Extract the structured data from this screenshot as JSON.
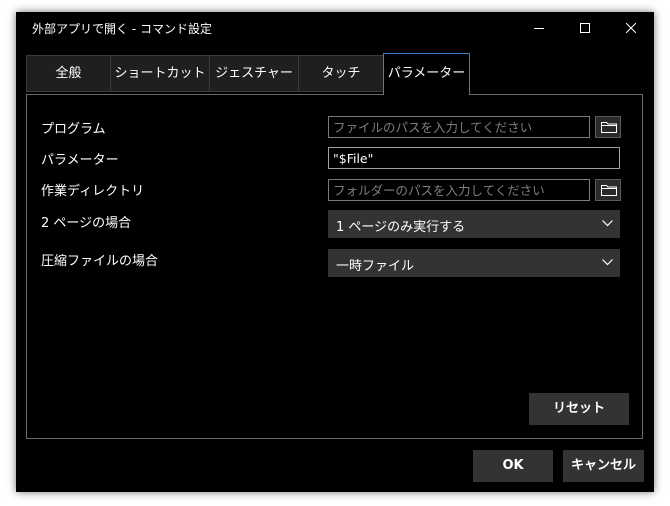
{
  "window": {
    "title": "外部アプリで開く - コマンド設定"
  },
  "tabs": [
    {
      "label": "全般"
    },
    {
      "label": "ショートカット"
    },
    {
      "label": "ジェスチャー"
    },
    {
      "label": "タッチ"
    },
    {
      "label": "パラメーター",
      "active": true
    }
  ],
  "form": {
    "program": {
      "label": "プログラム",
      "value": "",
      "placeholder": "ファイルのパスを入力してください"
    },
    "parameter": {
      "label": "パラメーター",
      "value": "\"$File\""
    },
    "workdir": {
      "label": "作業ディレクトリ",
      "value": "",
      "placeholder": "フォルダーのパスを入力してください"
    },
    "two_page": {
      "label": "2 ページの場合",
      "selected": "1 ページのみ実行する"
    },
    "archive": {
      "label": "圧縮ファイルの場合",
      "selected": "一時ファイル"
    }
  },
  "buttons": {
    "reset": "リセット",
    "ok": "OK",
    "cancel": "キャンセル"
  },
  "icons": {
    "folder": "folder-icon",
    "dropdown": "chevron-down-icon",
    "minimize": "minimize-icon",
    "maximize": "maximize-icon",
    "close": "close-icon"
  },
  "colors": {
    "background": "#000000",
    "control": "#333333",
    "active_tab_border": "#3c7fc4"
  }
}
